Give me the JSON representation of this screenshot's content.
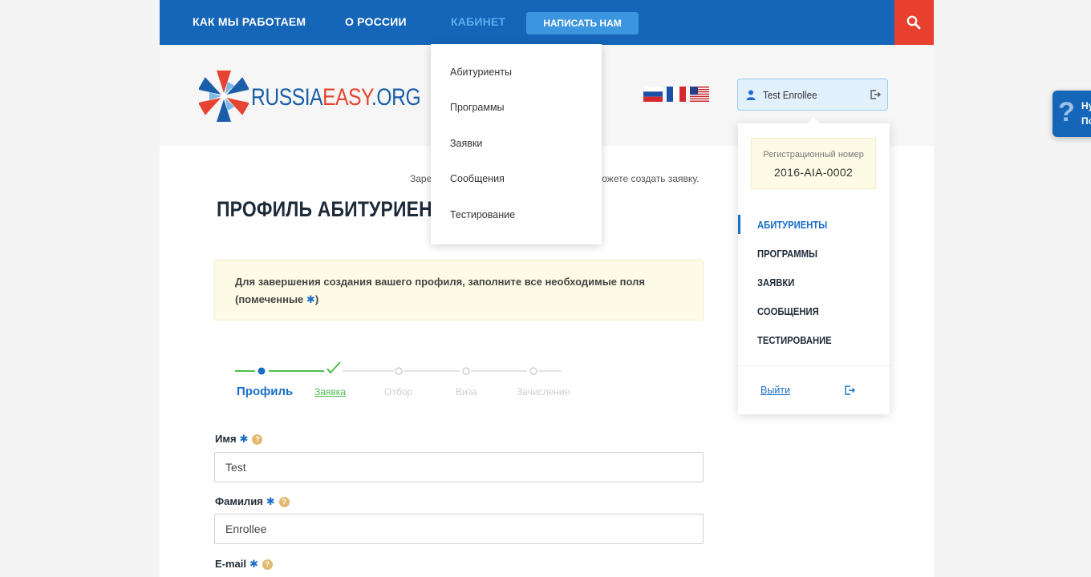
{
  "topnav": {
    "how_we_work": "Как мы работаем",
    "about_russia": "О России",
    "cabinet": "Кабинет",
    "write_us": "Написать нам"
  },
  "logo": {
    "part1": "RUSSIA",
    "part2": "EASY",
    "part3": ".ORG"
  },
  "user": {
    "name": "Test Enrollee"
  },
  "dropdown": {
    "items": [
      "Абитуриенты",
      "Программы",
      "Заявки",
      "Сообщения",
      "Тестирование"
    ]
  },
  "side_panel": {
    "reg_label": "Регистрационный номер",
    "reg_number": "2016-AIA-0002",
    "items": [
      "Абитуриенты",
      "Программы",
      "Заявки",
      "Сообщения",
      "Тестирование"
    ],
    "logout": "Выйти"
  },
  "main": {
    "hint_left": "Заре",
    "hint_right": "можете создать заявку.",
    "title": "ПРОФИЛЬ АБИТУРИЕНТА",
    "notice_text": "Для завершения создания вашего профиля, заполните все необходимые поля (помеченные ",
    "notice_star": "✱",
    "notice_end": ")"
  },
  "steps": [
    "Профиль",
    "Заявка",
    "Отбор",
    "Виза",
    "Зачисление"
  ],
  "form": {
    "first_name_label": "Имя",
    "first_name_value": "Test",
    "last_name_label": "Фамилия",
    "last_name_value": "Enrollee",
    "email_label": "E-mail",
    "required_mark": "✱",
    "help_mark": "?"
  },
  "help_tab": {
    "line1": "Ну",
    "line2": "По"
  },
  "colors": {
    "brand_blue": "#1565b8",
    "accent_red": "#e8402f",
    "step_green": "#4cbd51",
    "link_blue": "#1a6ec7"
  }
}
